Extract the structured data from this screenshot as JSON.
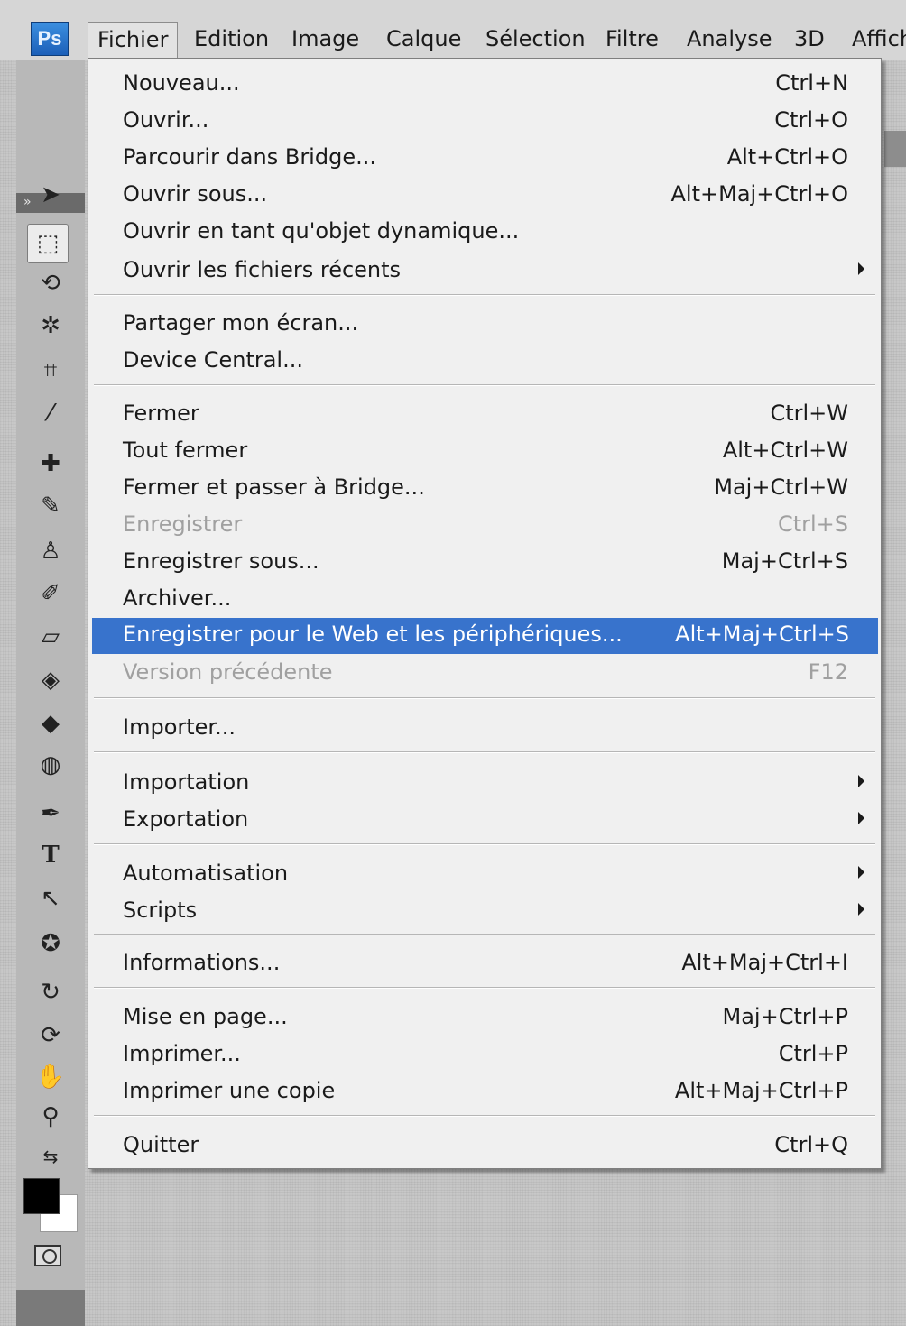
{
  "app": {
    "logo_text": "Ps",
    "accent": "#3873cc"
  },
  "menubar": {
    "items": [
      "Fichier",
      "Edition",
      "Image",
      "Calque",
      "Sélection",
      "Filtre",
      "Analyse",
      "3D",
      "Affich"
    ]
  },
  "menu": {
    "items": [
      {
        "label": "Nouveau...",
        "shortcut": "Ctrl+N"
      },
      {
        "label": "Ouvrir...",
        "shortcut": "Ctrl+O"
      },
      {
        "label": "Parcourir dans Bridge...",
        "shortcut": "Alt+Ctrl+O"
      },
      {
        "label": "Ouvrir sous...",
        "shortcut": "Alt+Maj+Ctrl+O"
      },
      {
        "label": "Ouvrir en tant qu'objet dynamique...",
        "shortcut": ""
      },
      {
        "label": "Ouvrir les fichiers récents",
        "shortcut": ""
      },
      {
        "label": "Partager mon écran...",
        "shortcut": ""
      },
      {
        "label": "Device Central...",
        "shortcut": ""
      },
      {
        "label": "Fermer",
        "shortcut": "Ctrl+W"
      },
      {
        "label": "Tout fermer",
        "shortcut": "Alt+Ctrl+W"
      },
      {
        "label": "Fermer et passer à Bridge...",
        "shortcut": "Maj+Ctrl+W"
      },
      {
        "label": "Enregistrer",
        "shortcut": "Ctrl+S"
      },
      {
        "label": "Enregistrer sous...",
        "shortcut": "Maj+Ctrl+S"
      },
      {
        "label": "Archiver...",
        "shortcut": ""
      },
      {
        "label": "Enregistrer pour le Web et les périphériques...",
        "shortcut": "Alt+Maj+Ctrl+S"
      },
      {
        "label": "Version précédente",
        "shortcut": "F12"
      },
      {
        "label": "Importer...",
        "shortcut": ""
      },
      {
        "label": "Importation",
        "shortcut": ""
      },
      {
        "label": "Exportation",
        "shortcut": ""
      },
      {
        "label": "Automatisation",
        "shortcut": ""
      },
      {
        "label": "Scripts",
        "shortcut": ""
      },
      {
        "label": "Informations...",
        "shortcut": "Alt+Maj+Ctrl+I"
      },
      {
        "label": "Mise en page...",
        "shortcut": "Maj+Ctrl+P"
      },
      {
        "label": "Imprimer...",
        "shortcut": "Ctrl+P"
      },
      {
        "label": "Imprimer une copie",
        "shortcut": "Alt+Maj+Ctrl+P"
      },
      {
        "label": "Quitter",
        "shortcut": "Ctrl+Q"
      }
    ]
  },
  "toolbar": {
    "collapse_glyph": "»",
    "tools": [
      {
        "name": "move-tool-icon",
        "glyph": "➤"
      },
      {
        "name": "rectangular-marquee-tool-icon",
        "glyph": "⬚"
      },
      {
        "name": "lasso-tool-icon",
        "glyph": "⟲"
      },
      {
        "name": "magic-wand-tool-icon",
        "glyph": "✲"
      },
      {
        "name": "crop-tool-icon",
        "glyph": "⌗"
      },
      {
        "name": "eyedropper-tool-icon",
        "glyph": "⁄"
      },
      {
        "name": "healing-brush-tool-icon",
        "glyph": "✚"
      },
      {
        "name": "brush-tool-icon",
        "glyph": "✎"
      },
      {
        "name": "clone-stamp-tool-icon",
        "glyph": "♙"
      },
      {
        "name": "history-brush-tool-icon",
        "glyph": "✐"
      },
      {
        "name": "eraser-tool-icon",
        "glyph": "▱"
      },
      {
        "name": "paint-bucket-tool-icon",
        "glyph": "◈"
      },
      {
        "name": "blur-tool-icon",
        "glyph": "◆"
      },
      {
        "name": "dodge-tool-icon",
        "glyph": "◍"
      },
      {
        "name": "pen-tool-icon",
        "glyph": "✒"
      },
      {
        "name": "type-tool-icon",
        "glyph": "T"
      },
      {
        "name": "path-selection-tool-icon",
        "glyph": "↖"
      },
      {
        "name": "shape-tool-icon",
        "glyph": "✪"
      },
      {
        "name": "3d-rotate-tool-icon",
        "glyph": "↻"
      },
      {
        "name": "3d-orbit-tool-icon",
        "glyph": "⟳"
      },
      {
        "name": "hand-tool-icon",
        "glyph": "✋"
      },
      {
        "name": "zoom-tool-icon",
        "glyph": "⚲"
      },
      {
        "name": "swap-colors-icon",
        "glyph": "⇆"
      }
    ]
  }
}
